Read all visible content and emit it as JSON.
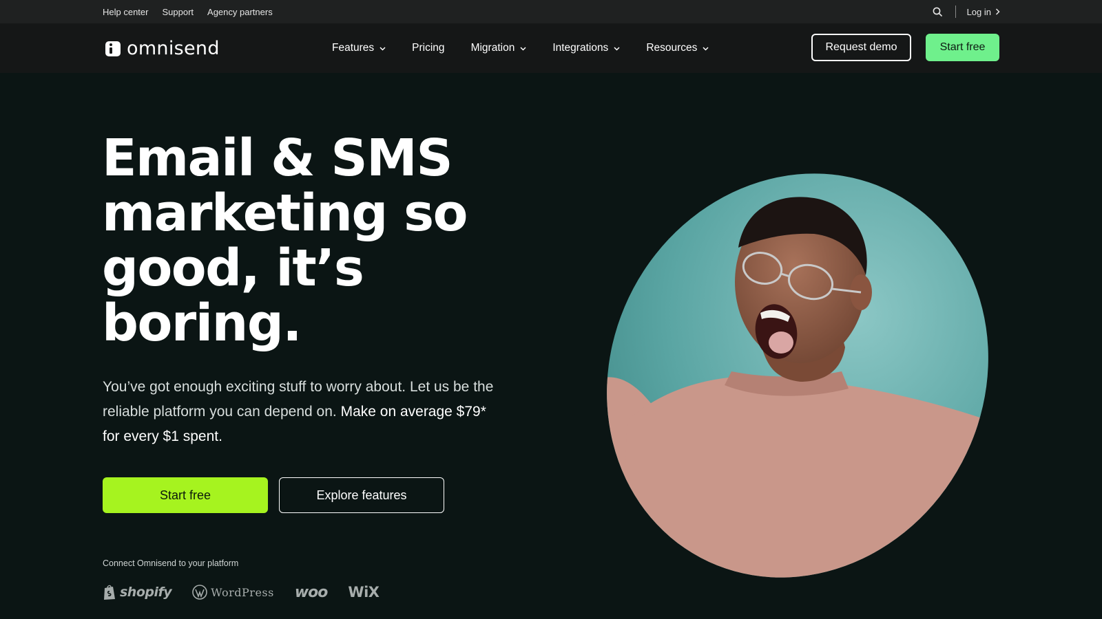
{
  "utility_bar": {
    "links": [
      "Help center",
      "Support",
      "Agency partners"
    ],
    "login_label": "Log in"
  },
  "nav": {
    "logo_text": "omnisend",
    "items": [
      {
        "label": "Features",
        "has_dropdown": true
      },
      {
        "label": "Pricing",
        "has_dropdown": false
      },
      {
        "label": "Migration",
        "has_dropdown": true
      },
      {
        "label": "Integrations",
        "has_dropdown": true
      },
      {
        "label": "Resources",
        "has_dropdown": true
      }
    ],
    "request_demo_label": "Request demo",
    "start_free_label": "Start free"
  },
  "hero": {
    "title_lines": [
      "Email & SMS",
      "marketing so",
      "good, it’s",
      "boring."
    ],
    "subtitle_regular": "You’ve got enough exciting stuff to worry about. Let us be the reliable platform you can depend on.",
    "subtitle_strong": "Make on average $79* for every $1 spent.",
    "start_free_label": "Start free",
    "explore_label": "Explore features",
    "connect_label": "Connect Omnisend to your platform",
    "platforms": [
      "shopify",
      "WordPress",
      "woo",
      "WiX"
    ]
  },
  "colors": {
    "background": "#0b1514",
    "utility_bar": "#1f2121",
    "nav_bar": "#151717",
    "nav_start_button": "#6ff08c",
    "hero_start_button": "#a6f31f",
    "photo_backdrop": "#5aa5a3",
    "sweater": "#c9978a"
  },
  "icons": {
    "search": "search-icon",
    "login_arrow": "chevron-right-icon",
    "dropdown": "chevron-down-icon",
    "logo": "omnisend-logo-icon"
  }
}
